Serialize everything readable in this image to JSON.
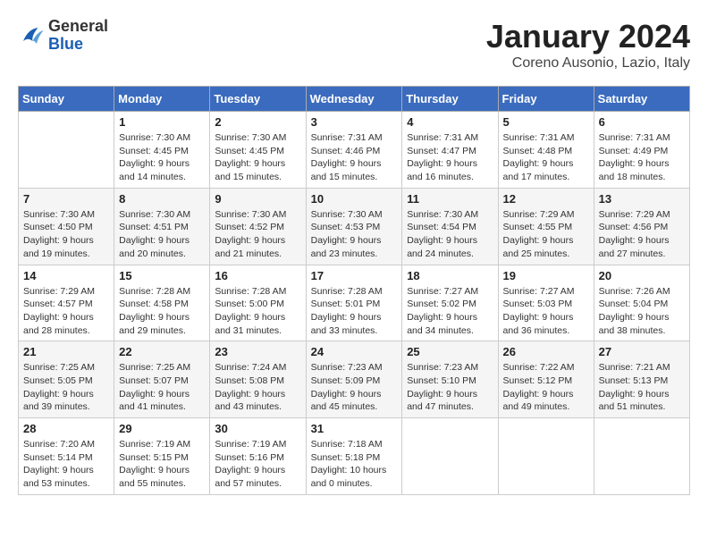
{
  "header": {
    "logo_general": "General",
    "logo_blue": "Blue",
    "month_title": "January 2024",
    "location": "Coreno Ausonio, Lazio, Italy"
  },
  "weekdays": [
    "Sunday",
    "Monday",
    "Tuesday",
    "Wednesday",
    "Thursday",
    "Friday",
    "Saturday"
  ],
  "weeks": [
    [
      {
        "day": "",
        "info": ""
      },
      {
        "day": "1",
        "info": "Sunrise: 7:30 AM\nSunset: 4:45 PM\nDaylight: 9 hours\nand 14 minutes."
      },
      {
        "day": "2",
        "info": "Sunrise: 7:30 AM\nSunset: 4:45 PM\nDaylight: 9 hours\nand 15 minutes."
      },
      {
        "day": "3",
        "info": "Sunrise: 7:31 AM\nSunset: 4:46 PM\nDaylight: 9 hours\nand 15 minutes."
      },
      {
        "day": "4",
        "info": "Sunrise: 7:31 AM\nSunset: 4:47 PM\nDaylight: 9 hours\nand 16 minutes."
      },
      {
        "day": "5",
        "info": "Sunrise: 7:31 AM\nSunset: 4:48 PM\nDaylight: 9 hours\nand 17 minutes."
      },
      {
        "day": "6",
        "info": "Sunrise: 7:31 AM\nSunset: 4:49 PM\nDaylight: 9 hours\nand 18 minutes."
      }
    ],
    [
      {
        "day": "7",
        "info": "Sunrise: 7:30 AM\nSunset: 4:50 PM\nDaylight: 9 hours\nand 19 minutes."
      },
      {
        "day": "8",
        "info": "Sunrise: 7:30 AM\nSunset: 4:51 PM\nDaylight: 9 hours\nand 20 minutes."
      },
      {
        "day": "9",
        "info": "Sunrise: 7:30 AM\nSunset: 4:52 PM\nDaylight: 9 hours\nand 21 minutes."
      },
      {
        "day": "10",
        "info": "Sunrise: 7:30 AM\nSunset: 4:53 PM\nDaylight: 9 hours\nand 23 minutes."
      },
      {
        "day": "11",
        "info": "Sunrise: 7:30 AM\nSunset: 4:54 PM\nDaylight: 9 hours\nand 24 minutes."
      },
      {
        "day": "12",
        "info": "Sunrise: 7:29 AM\nSunset: 4:55 PM\nDaylight: 9 hours\nand 25 minutes."
      },
      {
        "day": "13",
        "info": "Sunrise: 7:29 AM\nSunset: 4:56 PM\nDaylight: 9 hours\nand 27 minutes."
      }
    ],
    [
      {
        "day": "14",
        "info": "Sunrise: 7:29 AM\nSunset: 4:57 PM\nDaylight: 9 hours\nand 28 minutes."
      },
      {
        "day": "15",
        "info": "Sunrise: 7:28 AM\nSunset: 4:58 PM\nDaylight: 9 hours\nand 29 minutes."
      },
      {
        "day": "16",
        "info": "Sunrise: 7:28 AM\nSunset: 5:00 PM\nDaylight: 9 hours\nand 31 minutes."
      },
      {
        "day": "17",
        "info": "Sunrise: 7:28 AM\nSunset: 5:01 PM\nDaylight: 9 hours\nand 33 minutes."
      },
      {
        "day": "18",
        "info": "Sunrise: 7:27 AM\nSunset: 5:02 PM\nDaylight: 9 hours\nand 34 minutes."
      },
      {
        "day": "19",
        "info": "Sunrise: 7:27 AM\nSunset: 5:03 PM\nDaylight: 9 hours\nand 36 minutes."
      },
      {
        "day": "20",
        "info": "Sunrise: 7:26 AM\nSunset: 5:04 PM\nDaylight: 9 hours\nand 38 minutes."
      }
    ],
    [
      {
        "day": "21",
        "info": "Sunrise: 7:25 AM\nSunset: 5:05 PM\nDaylight: 9 hours\nand 39 minutes."
      },
      {
        "day": "22",
        "info": "Sunrise: 7:25 AM\nSunset: 5:07 PM\nDaylight: 9 hours\nand 41 minutes."
      },
      {
        "day": "23",
        "info": "Sunrise: 7:24 AM\nSunset: 5:08 PM\nDaylight: 9 hours\nand 43 minutes."
      },
      {
        "day": "24",
        "info": "Sunrise: 7:23 AM\nSunset: 5:09 PM\nDaylight: 9 hours\nand 45 minutes."
      },
      {
        "day": "25",
        "info": "Sunrise: 7:23 AM\nSunset: 5:10 PM\nDaylight: 9 hours\nand 47 minutes."
      },
      {
        "day": "26",
        "info": "Sunrise: 7:22 AM\nSunset: 5:12 PM\nDaylight: 9 hours\nand 49 minutes."
      },
      {
        "day": "27",
        "info": "Sunrise: 7:21 AM\nSunset: 5:13 PM\nDaylight: 9 hours\nand 51 minutes."
      }
    ],
    [
      {
        "day": "28",
        "info": "Sunrise: 7:20 AM\nSunset: 5:14 PM\nDaylight: 9 hours\nand 53 minutes."
      },
      {
        "day": "29",
        "info": "Sunrise: 7:19 AM\nSunset: 5:15 PM\nDaylight: 9 hours\nand 55 minutes."
      },
      {
        "day": "30",
        "info": "Sunrise: 7:19 AM\nSunset: 5:16 PM\nDaylight: 9 hours\nand 57 minutes."
      },
      {
        "day": "31",
        "info": "Sunrise: 7:18 AM\nSunset: 5:18 PM\nDaylight: 10 hours\nand 0 minutes."
      },
      {
        "day": "",
        "info": ""
      },
      {
        "day": "",
        "info": ""
      },
      {
        "day": "",
        "info": ""
      }
    ]
  ]
}
